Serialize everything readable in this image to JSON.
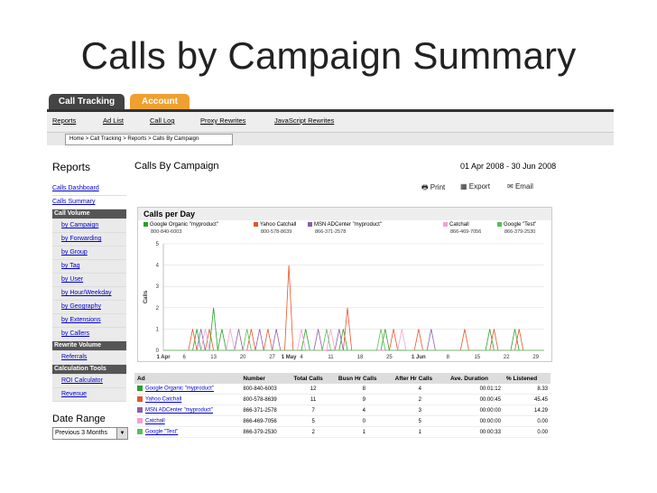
{
  "slide": {
    "title": "Calls by Campaign Summary"
  },
  "tabs": [
    {
      "label": "Call Tracking"
    },
    {
      "label": "Account"
    }
  ],
  "subnav": [
    "Reports",
    "Ad List",
    "Call Log",
    "Proxy Rewrites",
    "JavaScript Rewrites"
  ],
  "breadcrumb": "Home > Call Tracking > Reports > Calls By Campaign",
  "sidebar": {
    "title": "Reports",
    "items": [
      {
        "label": "Calls Dashboard",
        "kind": "link"
      },
      {
        "label": "Calls Summary",
        "kind": "link"
      },
      {
        "label": "Call Volume",
        "kind": "header"
      },
      {
        "label": "by Campaign",
        "kind": "sub"
      },
      {
        "label": "by Forwarding",
        "kind": "sub"
      },
      {
        "label": "by Group",
        "kind": "sub"
      },
      {
        "label": "by Tag",
        "kind": "sub"
      },
      {
        "label": "by User",
        "kind": "sub"
      },
      {
        "label": "by Hour/Weekday",
        "kind": "sub"
      },
      {
        "label": "by Geography",
        "kind": "sub"
      },
      {
        "label": "by Extensions",
        "kind": "sub"
      },
      {
        "label": "by Callers",
        "kind": "sub"
      },
      {
        "label": "Rewrite Volume",
        "kind": "header"
      },
      {
        "label": "Referrals",
        "kind": "sub"
      },
      {
        "label": "Calculation Tools",
        "kind": "header"
      },
      {
        "label": "ROI Calculator",
        "kind": "sub"
      },
      {
        "label": "Revenue",
        "kind": "sub"
      }
    ],
    "date_range_label": "Date Range",
    "date_range_value": "Previous 3 Months"
  },
  "main": {
    "title": "Calls By Campaign",
    "date": "01 Apr 2008 - 30 Jun 2008",
    "actions": {
      "print": "Print",
      "export": "Export",
      "email": "Email"
    }
  },
  "chart_data": {
    "type": "line",
    "title": "Calls per Day",
    "ylabel": "Calls",
    "ylim": [
      0,
      5
    ],
    "y_ticks": [
      "0",
      "1",
      "2",
      "3",
      "4",
      "5"
    ],
    "x_ticks": [
      "1 Apr",
      "6",
      "13",
      "20",
      "27",
      "1 May",
      "4",
      "11",
      "18",
      "25",
      "1 Jun",
      "8",
      "15",
      "22",
      "29"
    ],
    "series": [
      {
        "name": "Google Organic \"myproduct\"",
        "number": "800-840-6003",
        "color": "#2ca02c",
        "peaks": [
          [
            8,
            1
          ],
          [
            12,
            2
          ],
          [
            14,
            1
          ],
          [
            34,
            1
          ],
          [
            43,
            1
          ],
          [
            53,
            1
          ],
          [
            78,
            1
          ],
          [
            84,
            1
          ]
        ]
      },
      {
        "name": "Yahoo Catchall",
        "number": "800-578-8639",
        "color": "#e8542a",
        "peaks": [
          [
            7,
            1
          ],
          [
            11,
            1
          ],
          [
            21,
            1
          ],
          [
            25,
            1
          ],
          [
            30,
            4
          ],
          [
            44,
            2
          ],
          [
            55,
            1
          ],
          [
            61,
            1
          ],
          [
            72,
            1
          ],
          [
            79,
            1
          ],
          [
            85,
            1
          ]
        ]
      },
      {
        "name": "MSN ADCenter \"myproduct\"",
        "number": "866-371-2578",
        "color": "#8a5ea8",
        "peaks": [
          [
            9,
            1
          ],
          [
            18,
            1
          ],
          [
            23,
            1
          ],
          [
            27,
            1
          ],
          [
            37,
            1
          ],
          [
            42,
            1
          ],
          [
            64,
            1
          ]
        ]
      },
      {
        "name": "Catchall",
        "number": "866-469-7056",
        "color": "#f2a0d0",
        "peaks": [
          [
            10,
            1
          ],
          [
            16,
            1
          ],
          [
            33,
            1
          ],
          [
            40,
            1
          ],
          [
            57,
            1
          ]
        ]
      },
      {
        "name": "Google \"Test\"",
        "number": "866-379-2530",
        "color": "#55c055",
        "peaks": [
          [
            20,
            1
          ],
          [
            39,
            1
          ],
          [
            52,
            1
          ]
        ]
      }
    ]
  },
  "table": {
    "headers": [
      "Ad",
      "Number",
      "Total Calls",
      "Busn Hr Calls",
      "After Hr Calls",
      "Ave. Duration",
      "% Listened"
    ],
    "rows": [
      {
        "ad": "Google Organic \"myproduct\"",
        "color": "#2ca02c",
        "number": "800-840-6003",
        "total": "12",
        "busn": "8",
        "after": "4",
        "duration": "00:01:12",
        "listened": "8.33"
      },
      {
        "ad": "Yahoo Catchall",
        "color": "#e8542a",
        "number": "800-578-8639",
        "total": "11",
        "busn": "9",
        "after": "2",
        "duration": "00:00:45",
        "listened": "45.45"
      },
      {
        "ad": "MSN ADCenter \"myproduct\"",
        "color": "#8a5ea8",
        "number": "866-371-2578",
        "total": "7",
        "busn": "4",
        "after": "3",
        "duration": "00:00:00",
        "listened": "14.29"
      },
      {
        "ad": "Catchall",
        "color": "#f2a0d0",
        "number": "866-469-7056",
        "total": "5",
        "busn": "0",
        "after": "5",
        "duration": "00:00:00",
        "listened": "0.00"
      },
      {
        "ad": "Google \"Test\"",
        "color": "#55c055",
        "number": "866-379-2530",
        "total": "2",
        "busn": "1",
        "after": "1",
        "duration": "00:00:33",
        "listened": "0.00"
      }
    ]
  }
}
